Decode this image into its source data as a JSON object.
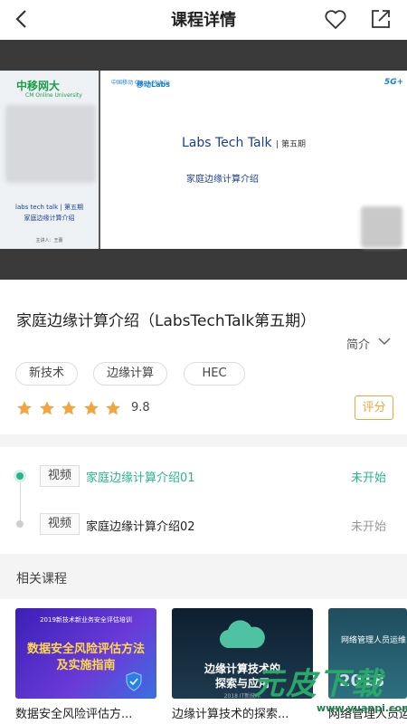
{
  "header": {
    "title": "课程详情",
    "back_icon": "chevron-left-icon",
    "favorite_icon": "heart-outline-icon",
    "share_icon": "share-external-icon"
  },
  "player": {
    "left_slide": {
      "logo": "中移网大",
      "logo_sub": "CM Online University",
      "line1": "labs tech talk | 第五期",
      "line2": "家庭边缘计算介绍",
      "line3": "主讲人：王蕾"
    },
    "main_slide": {
      "cm_logo": "中国移动 China Mobile",
      "labs_logo": "移动Labs",
      "badge_5g": "5G+",
      "title": "Labs Tech Talk",
      "title_suffix": "| 第五期",
      "subtitle": "家庭边缘计算介绍"
    }
  },
  "course": {
    "title": "家庭边缘计算介绍（LabsTechTalk第五期）",
    "intro_label": "简介",
    "tags": [
      "新技术",
      "边缘计算",
      "HEC"
    ],
    "rating": 5,
    "rating_max": 5,
    "score_text": "9.8",
    "rate_button": "评分"
  },
  "lessons": [
    {
      "tag": "视频",
      "title": "家庭边缘计算介绍01",
      "status": "未开始",
      "active": true
    },
    {
      "tag": "视频",
      "title": "家庭边缘计算介绍02",
      "status": "未开始",
      "active": false
    }
  ],
  "related": {
    "label": "相关课程",
    "items": [
      {
        "title": "数据安全风险评估方...",
        "thumb_top": "2019新技术新业务安全评估培训",
        "thumb_line1": "数据安全风险评估方法",
        "thumb_line2": "及实施指南"
      },
      {
        "title": "边缘计算技术的探索...",
        "thumb_line1": "边缘计算技术的",
        "thumb_line2": "探索与应用",
        "thumb_line3": "2018 IT新技术"
      },
      {
        "title": "网络管理人员运维优工",
        "thumb_line1": "网络管理人员运维",
        "thumb_line2": "2018"
      }
    ]
  },
  "watermark": {
    "text": "元皮下载",
    "url": "www.yuanpi.com"
  },
  "colors": {
    "accent_green": "#2bb48c",
    "star_orange": "#f0a640",
    "muted_text": "#999999"
  }
}
